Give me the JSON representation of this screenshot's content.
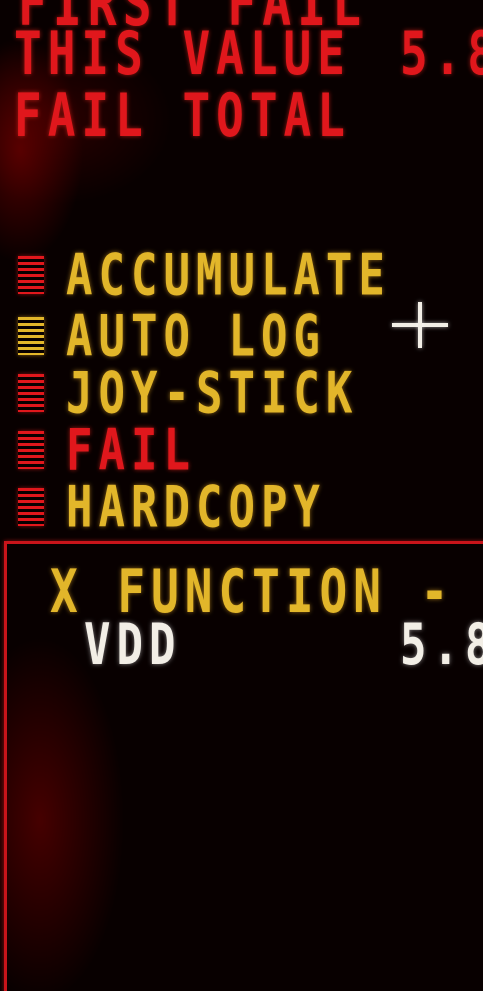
{
  "status": {
    "top_cut_line": "FIRST FAIL",
    "this_value_label": "THIS VALUE",
    "this_value_number": "5.8",
    "fail_total_label": "FAIL TOTAL"
  },
  "menu": {
    "items": [
      {
        "label": "ACCUMULATE",
        "label_color": "#e2b62a",
        "marker_color": "#e0171c"
      },
      {
        "label": "AUTO LOG",
        "label_color": "#e2b62a",
        "marker_color": "#e2b62a"
      },
      {
        "label": "JOY-STICK",
        "label_color": "#e2b62a",
        "marker_color": "#e0171c"
      },
      {
        "label": "FAIL",
        "label_color": "#e0171c",
        "marker_color": "#e0171c"
      },
      {
        "label": "HARDCOPY",
        "label_color": "#e2b62a",
        "marker_color": "#e0171c"
      }
    ]
  },
  "cursor": {
    "icon": "crosshair-icon"
  },
  "function_panel": {
    "title": "X FUNCTION - V",
    "row_label": "VDD",
    "row_value": "5.8"
  },
  "colors": {
    "red": "#e0171c",
    "amber": "#e2b62a",
    "white": "#f2eee6",
    "background": "#080000"
  }
}
